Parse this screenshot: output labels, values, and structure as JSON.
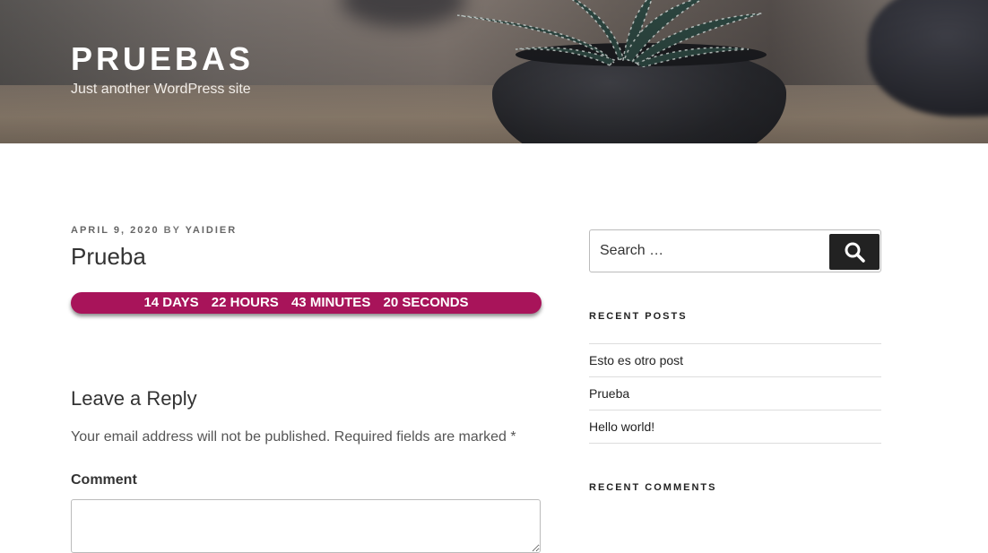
{
  "header": {
    "site_title": "PRUEBAS",
    "site_description": "Just another WordPress site"
  },
  "post": {
    "date": "APRIL 9, 2020",
    "by": "BY",
    "author": "YAIDIER",
    "title": "Prueba",
    "countdown": {
      "days": "14 DAYS",
      "hours": "22 HOURS",
      "minutes": "43 MINUTES",
      "seconds": "20 SECONDS",
      "color": "#a8145a"
    }
  },
  "comments": {
    "reply_title": "Leave a Reply",
    "note": "Your email address will not be published. Required fields are marked",
    "required_mark": "*",
    "comment_label": "Comment"
  },
  "sidebar": {
    "search": {
      "placeholder": "Search …",
      "button_icon": "search-icon"
    },
    "recent_posts": {
      "title": "RECENT POSTS",
      "items": [
        {
          "label": "Esto es otro post"
        },
        {
          "label": "Prueba"
        },
        {
          "label": "Hello world!"
        }
      ]
    },
    "recent_comments": {
      "title": "RECENT COMMENTS"
    }
  }
}
